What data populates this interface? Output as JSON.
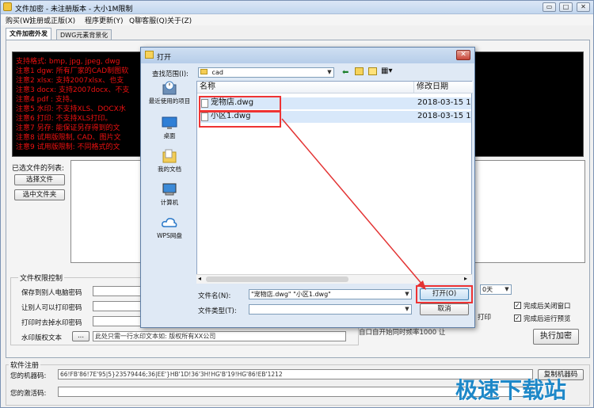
{
  "window": {
    "title": "文件加密 - 未注册版本 - 大小1M限制",
    "minimize": "▭",
    "maximize": "□",
    "close": "✕"
  },
  "menu": [
    "购买(W)",
    "注册或正版(X)",
    "程序更新(Y)",
    "Q聊客服(Q)",
    "关于(Z)"
  ],
  "tabs": [
    "文件加密外发",
    "DWG元素背景化"
  ],
  "info_lines": [
    "支持格式: bmp, jpg, jpeg, dwg",
    "注意1 dgw: 所有厂家的CAD制图软",
    "注意2 xlsx: 支持2007xlsx、也支",
    "注意3 docx: 支持2007docx、不支",
    "注意4 pdf : 支持。",
    "注意5 水印: 不支持XLS、DOCX水",
    "注意6 打印: 不支持XLS打印。",
    "注意7 另存: 能保证另存得到的文",
    "注意8 试用版限制, CAD、图片文",
    "注意9 试用版限制: 不同格式的文"
  ],
  "file_list_label": "已选文件的列表:",
  "buttons": {
    "select_file": "选择文件",
    "select_folder": "选中文件夹",
    "execute_encrypt": "执行加密",
    "copy_machine_code": "复制机器码",
    "browse": "...",
    "open": "打开(O)",
    "cancel": "取消"
  },
  "permissions": {
    "title": "文件权限控制",
    "save_password_label": "保存到别人电脑密码",
    "print_password_label": "让别人可以打印密码",
    "remove_watermark_label": "打印时去掉水印密码",
    "watermark_text_label": "水印版权文本",
    "watermark_text_value": "此处只需一行水印文本如: 版权所有XX公司",
    "days_value": "0天",
    "print_label": "打印",
    "partial_text": "自口自开始同时频率1000 让"
  },
  "options": {
    "close_after": "完成后关闭窗口",
    "run_preview": "完成后运行预览"
  },
  "registration": {
    "title": "软件注册",
    "machine_code_label": "您的机器码:",
    "machine_code_value": "66!FB'86!7E'95|5}23579446;36|EE'}HB'1D!36'3H!HG'B'19!HG'86!EB'1212",
    "activation_label": "您的激活码:",
    "activation_value": ""
  },
  "watermark_brand": "极速下载站",
  "dialog": {
    "title": "打开",
    "lookin_label": "查找范围(I):",
    "lookin_value": "cad",
    "places": [
      "最近使用的项目",
      "桌面",
      "我的文档",
      "计算机",
      "WPS网盘"
    ],
    "col_name": "名称",
    "col_date": "修改日期",
    "files": [
      {
        "name": "宠物店.dwg",
        "date": "2018-03-15 14"
      },
      {
        "name": "小区1.dwg",
        "date": "2018-03-15 14"
      }
    ],
    "filename_label": "文件名(N):",
    "filename_value": "\"宠物店.dwg\" \"小区1.dwg\"",
    "filetype_label": "文件类型(T):",
    "filetype_value": ""
  },
  "colors": {
    "info_text": "#e11111",
    "highlight_box": "#e33333",
    "brand": "#1e88c8"
  }
}
